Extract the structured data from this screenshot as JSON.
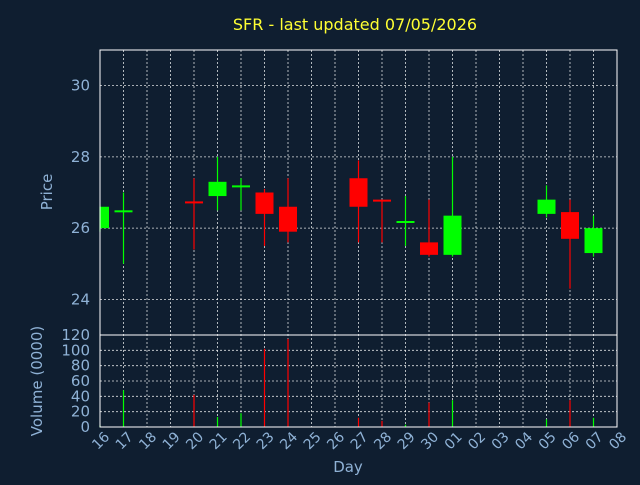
{
  "chart_data": {
    "type": "candlestick",
    "title": "SFR - last updated 07/05/2026",
    "xlabel": "Day",
    "ylabel": "Price",
    "volume_label": "Volume (0000)",
    "x_tick_labels": [
      "16",
      "17",
      "18",
      "19",
      "20",
      "21",
      "22",
      "23",
      "24",
      "25",
      "26",
      "27",
      "28",
      "29",
      "30",
      "01",
      "02",
      "03",
      "04",
      "05",
      "06",
      "07",
      "08"
    ],
    "price_ylim": [
      23,
      31
    ],
    "price_ticks": [
      24,
      26,
      28,
      30
    ],
    "volume_ylim": [
      0,
      120
    ],
    "volume_ticks": [
      0,
      20,
      40,
      60,
      80,
      100,
      120
    ],
    "grid": true,
    "up_color": "#00ff00",
    "down_color": "#ff0000",
    "candles": [
      {
        "day": "16",
        "open": 26.0,
        "high": 26.6,
        "low": 25.9,
        "close": 26.6,
        "volume": 2
      },
      {
        "day": "17",
        "open": 26.5,
        "high": 27.0,
        "low": 25.0,
        "close": 26.5,
        "volume": 48
      },
      {
        "day": "20",
        "open": 26.75,
        "high": 27.4,
        "low": 25.4,
        "close": 26.7,
        "volume": 42
      },
      {
        "day": "21",
        "open": 26.9,
        "high": 28.0,
        "low": 26.5,
        "close": 27.3,
        "volume": 13
      },
      {
        "day": "22",
        "open": 27.2,
        "high": 27.4,
        "low": 26.5,
        "close": 27.2,
        "volume": 18
      },
      {
        "day": "23",
        "open": 27.0,
        "high": 27.1,
        "low": 25.5,
        "close": 26.4,
        "volume": 102
      },
      {
        "day": "24",
        "open": 26.6,
        "high": 27.4,
        "low": 25.6,
        "close": 25.9,
        "volume": 115
      },
      {
        "day": "27",
        "open": 27.4,
        "high": 27.9,
        "low": 25.6,
        "close": 26.6,
        "volume": 12
      },
      {
        "day": "28",
        "open": 26.8,
        "high": 26.8,
        "low": 25.6,
        "close": 26.75,
        "volume": 8
      },
      {
        "day": "29",
        "open": 26.2,
        "high": 26.9,
        "low": 25.5,
        "close": 26.2,
        "volume": 3
      },
      {
        "day": "30",
        "open": 25.6,
        "high": 26.8,
        "low": 25.2,
        "close": 25.25,
        "volume": 32
      },
      {
        "day": "01",
        "open": 25.25,
        "high": 28.0,
        "low": 25.2,
        "close": 26.35,
        "volume": 35
      },
      {
        "day": "05",
        "open": 26.4,
        "high": 27.2,
        "low": 26.3,
        "close": 26.8,
        "volume": 10
      },
      {
        "day": "06",
        "open": 26.45,
        "high": 26.8,
        "low": 24.3,
        "close": 25.7,
        "volume": 35
      },
      {
        "day": "07",
        "open": 25.3,
        "high": 26.35,
        "low": 25.2,
        "close": 26.0,
        "volume": 12
      }
    ]
  }
}
